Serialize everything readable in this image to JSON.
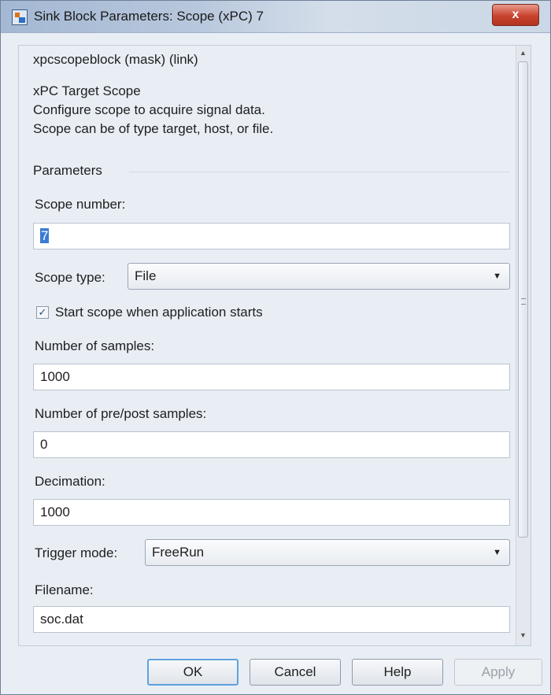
{
  "window": {
    "title": "Sink Block Parameters: Scope (xPC) 7",
    "close_label": "x"
  },
  "mask_header": "xpcscopeblock (mask) (link)",
  "description": [
    "xPC Target Scope",
    "Configure scope to acquire signal data.",
    "Scope can be of type target, host, or file."
  ],
  "parameters_group": "Parameters",
  "fields": {
    "scope_number": {
      "label": "Scope number:",
      "value": "7"
    },
    "scope_type": {
      "label": "Scope type:",
      "value": "File"
    },
    "start_scope": {
      "label": "Start scope when application starts",
      "checked": true
    },
    "num_samples": {
      "label": "Number of samples:",
      "value": "1000"
    },
    "pre_post": {
      "label": "Number of pre/post samples:",
      "value": "0"
    },
    "decimation": {
      "label": "Decimation:",
      "value": "1000"
    },
    "trigger_mode": {
      "label": "Trigger mode:",
      "value": "FreeRun"
    },
    "filename": {
      "label": "Filename:",
      "value": "soc.dat"
    }
  },
  "buttons": {
    "ok": "OK",
    "cancel": "Cancel",
    "help": "Help",
    "apply": "Apply"
  },
  "icons": {
    "checkbox": "checkmark-icon",
    "dropdown": "chevron-down-icon",
    "scroll_up": "scroll-up-icon",
    "scroll_down": "scroll-down-icon"
  }
}
